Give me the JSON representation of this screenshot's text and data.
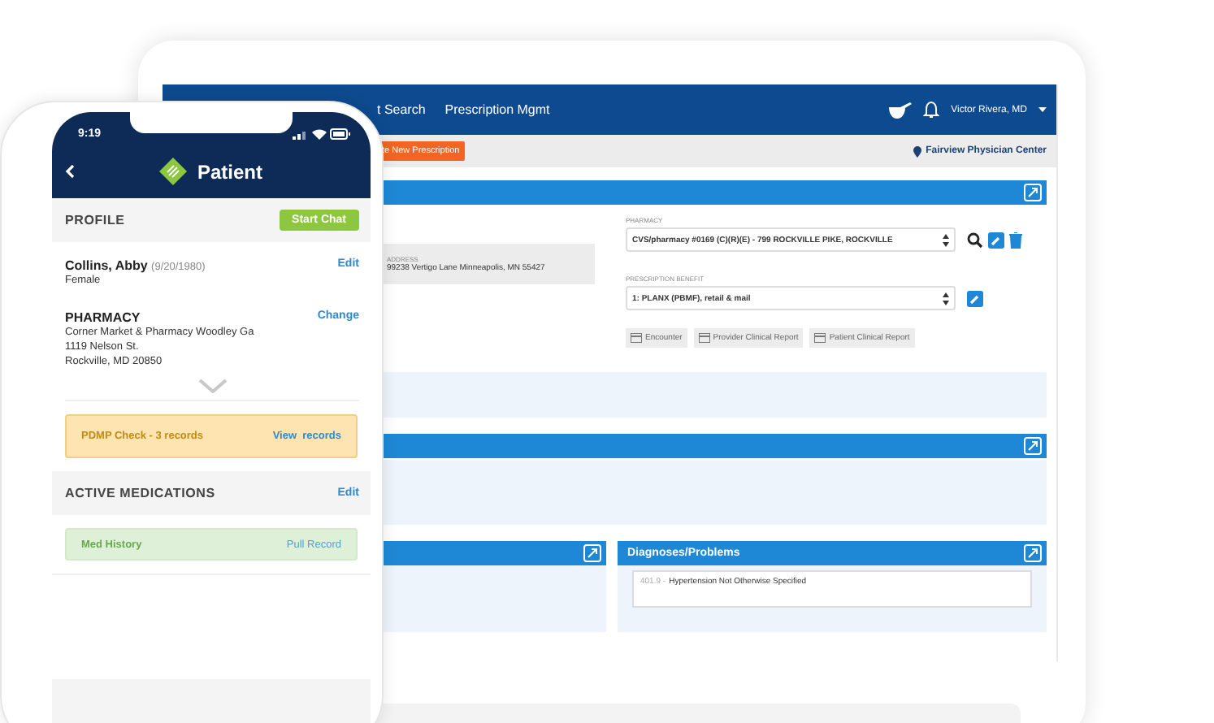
{
  "laptop": {
    "nav_items": [
      "t Search",
      "Prescription Mgmt"
    ],
    "user": "Victor Rivera, MD",
    "new_button": "te New Prescription",
    "location": "Fairview Physician Center",
    "address": {
      "label": "ADDRESS",
      "value": "99238 Vertigo Lane Minneapolis, MN 55427"
    },
    "pharmacy": {
      "label": "PHARMACY",
      "value": "CVS/pharmacy #0169 (C)(R)(E) - 799 ROCKVILLE PIKE, ROCKVILLE"
    },
    "benefit": {
      "label": "PRESCRIPTION BENEFIT",
      "value": "1: PLANX (PBMF), retail & mail"
    },
    "reports": [
      "Encounter",
      "Provider Clinical Report",
      "Patient Clinical Report"
    ],
    "diagnoses": {
      "title": "Diagnoses/Problems",
      "items": [
        {
          "code": "401.9 -",
          "text": "Hypertension Not Otherwise Specified"
        }
      ]
    }
  },
  "phone": {
    "time": "9:19",
    "title": "Patient",
    "profile": {
      "heading": "PROFILE",
      "action": "Start Chat"
    },
    "patient": {
      "name": "Collins, Abby",
      "dob": "(9/20/1980)",
      "sex": "Female",
      "action": "Edit"
    },
    "pharmacy": {
      "heading": "PHARMACY",
      "lines": [
        "Corner Market & Pharmacy Woodley Ga",
        "1119 Nelson St.",
        "Rockville, MD 20850"
      ],
      "action": "Change"
    },
    "alert": {
      "text": "PDMP Check - 3 records",
      "action": "View  records"
    },
    "medications": {
      "heading": "ACTIVE MEDICATIONS",
      "action": "Edit"
    },
    "med_history": {
      "label": "Med History",
      "action": "Pull Record"
    }
  }
}
